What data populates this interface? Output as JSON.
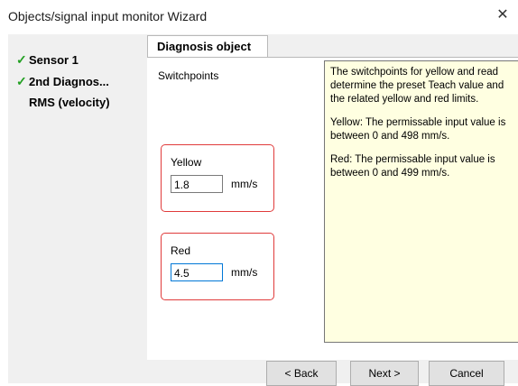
{
  "window": {
    "title": "Objects/signal input monitor Wizard",
    "close_glyph": "✕"
  },
  "nav": {
    "items": [
      {
        "label": "Sensor 1",
        "checked": true
      },
      {
        "label": "2nd Diagnos...",
        "checked": true
      },
      {
        "label": "RMS (velocity)",
        "checked": false
      }
    ]
  },
  "tab": {
    "label": "Diagnosis object"
  },
  "switchpoints": {
    "label": "Switchpoints"
  },
  "yellow": {
    "label": "Yellow",
    "value": "1.8",
    "unit": "mm/s"
  },
  "red": {
    "label": "Red",
    "value": "4.5",
    "unit": "mm/s"
  },
  "info": {
    "paragraphs": [
      "The switchpoints for yellow and read determine the preset Teach value and the related yellow and red limits.",
      "Yellow: The permissable input value is between 0 and 498 mm/s.",
      "Red: The permissable input value is between 0 and 499 mm/s."
    ]
  },
  "buttons": {
    "back": "< Back",
    "next": "Next >",
    "cancel": "Cancel"
  },
  "colors": {
    "info_bg": "#ffffe1",
    "group_border": "#e03b3b",
    "check": "#22a022",
    "focus": "#0078d7"
  }
}
